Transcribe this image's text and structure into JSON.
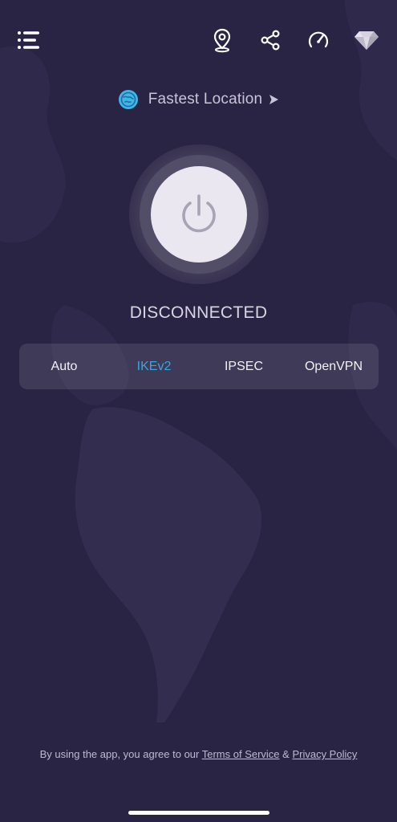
{
  "location": {
    "label": "Fastest Location"
  },
  "status": {
    "text": "DISCONNECTED"
  },
  "protocols": [
    {
      "label": "Auto",
      "active": false
    },
    {
      "label": "IKEv2",
      "active": true
    },
    {
      "label": "IPSEC",
      "active": false
    },
    {
      "label": "OpenVPN",
      "active": false
    }
  ],
  "footer": {
    "prefix": "By using the app, you agree to our ",
    "terms": "Terms of Service",
    "joiner": " & ",
    "privacy": "Privacy Policy"
  },
  "icons": {
    "menu": "menu-icon",
    "location": "location-pin-icon",
    "share": "share-icon",
    "speed": "speedometer-icon",
    "premium": "diamond-icon",
    "globe": "globe-icon",
    "arrow": "arrow-right-icon",
    "power": "power-icon"
  },
  "colors": {
    "background": "#2a2444",
    "accent": "#34a8e0",
    "power_button": "#ebe7f1"
  }
}
